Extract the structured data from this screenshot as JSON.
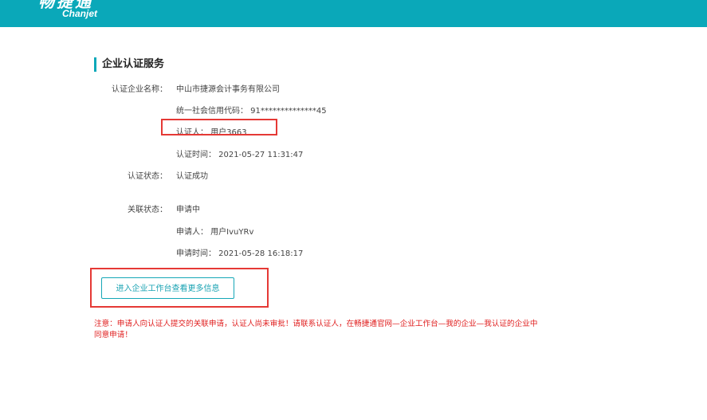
{
  "header": {
    "logo_cn": "畅捷通",
    "logo_en": "Chanjet",
    "bg_color": "#0aa8b9"
  },
  "section": {
    "title": "企业认证服务"
  },
  "certification": {
    "company_label": "认证企业名称：",
    "company_name": "中山市捷源会计事务有限公司",
    "credit_code": "统一社会信用代码：  91**************45",
    "certifier": "认证人：  用户3663",
    "cert_time": "认证时间：  2021-05-27 11:31:47",
    "status_label": "认证状态：",
    "status_value": "认证成功"
  },
  "association": {
    "status_label": "关联状态：",
    "status_value": "申请中",
    "applicant": "申请人：  用户IvuYRv",
    "apply_time": "申请时间：  2021-05-28 16:18:17"
  },
  "actions": {
    "enter_workbench_label": "进入企业工作台查看更多信息"
  },
  "notice": {
    "text": "注意：申请人向认证人提交的关联申请，认证人尚未审批！请联系认证人，在畅捷通官网—企业工作台—我的企业—我认证的企业中同意申请！",
    "color": "#e02020"
  },
  "annotation_color": "#e53935"
}
